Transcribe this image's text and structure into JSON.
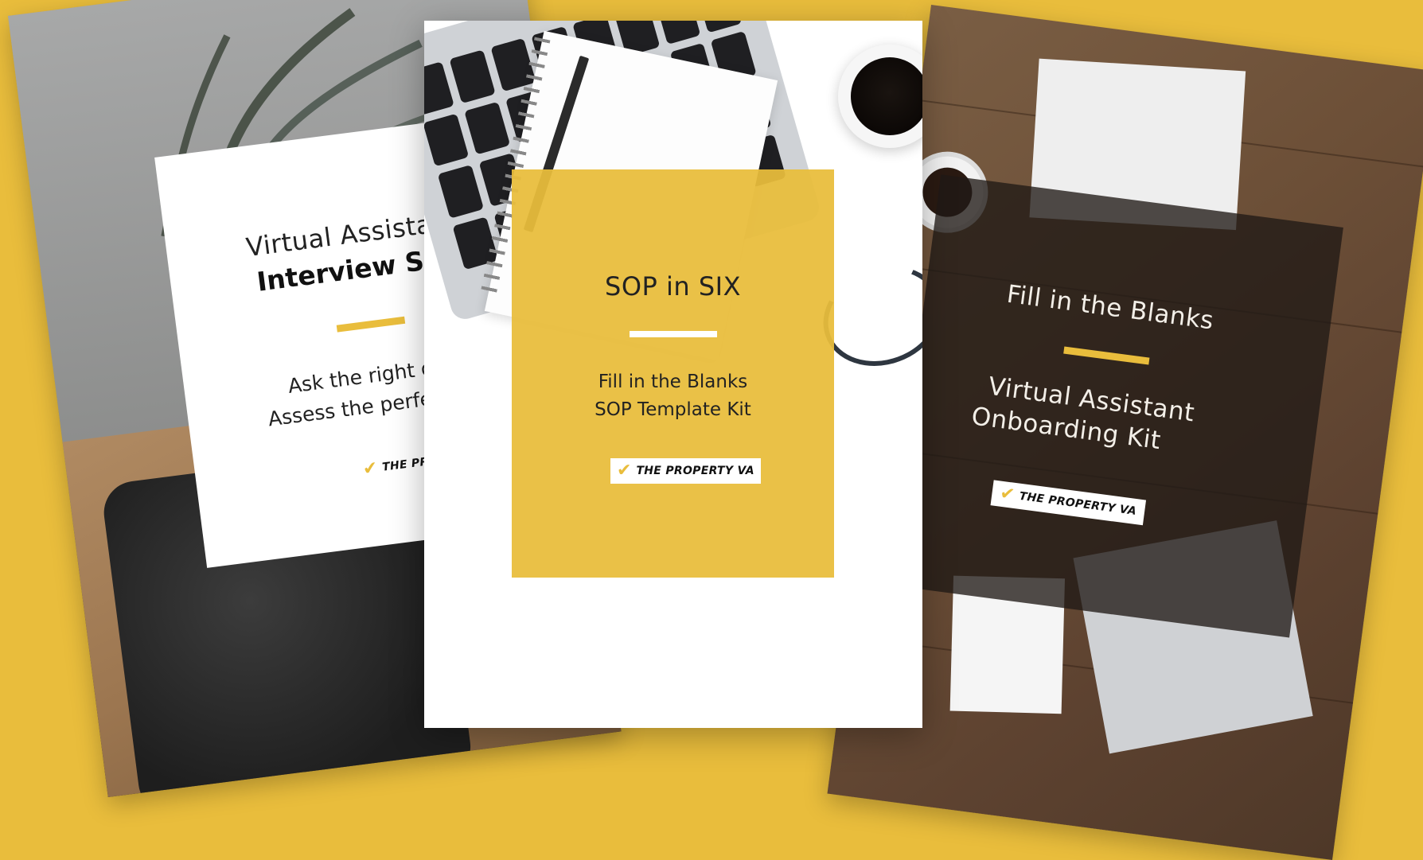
{
  "colors": {
    "background": "#e9bd3c",
    "accent": "#e9bd3c"
  },
  "left_booklet": {
    "title_line1": "Virtual Assistant",
    "title_line2": "Interview Sheet",
    "tagline_line1": "Ask the right questio",
    "tagline_line2": "Assess the perfect cand",
    "logo_text": "THE PROPERTY VA",
    "check_icon": "check-icon"
  },
  "center_booklet": {
    "title": "SOP in SIX",
    "subtitle_line1": "Fill in the Blanks",
    "subtitle_line2": "SOP Template Kit",
    "logo_text": "THE PROPERTY VA",
    "check_icon": "check-icon"
  },
  "right_booklet": {
    "title_line1": "Fill in the Blanks",
    "subtitle_line1": "Virtual Assistant",
    "subtitle_line2": "Onboarding Kit",
    "logo_text": "THE PROPERTY VA",
    "check_icon": "check-icon"
  }
}
